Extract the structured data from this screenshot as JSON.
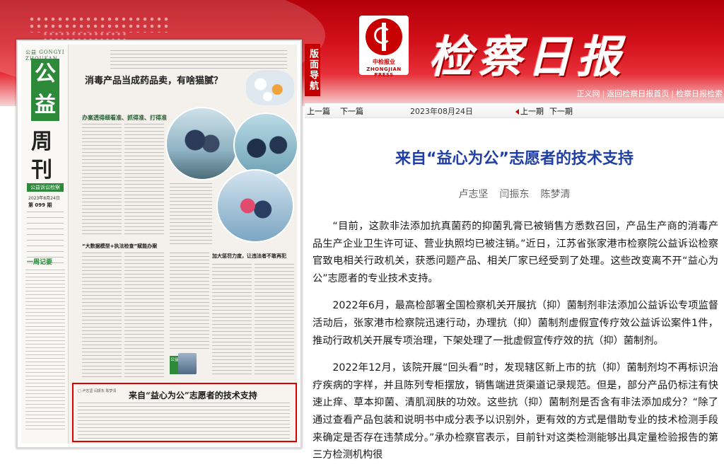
{
  "header": {
    "brand_title": "检察日报",
    "logo_cn": "中检报业",
    "logo_en": "ZHONGJIAN PRESS",
    "nav_tag": "版面导航",
    "links": [
      "正义网",
      "返回检察日报首页",
      "检察日报检索"
    ],
    "link_separator": "|"
  },
  "navbar": {
    "prev_article": "上一篇",
    "next_article": "下一篇",
    "date": "2023年08月24日",
    "prev_issue": "上一期",
    "next_issue": "下一期"
  },
  "newspaper": {
    "masthead_small": "公益 GONGYI ZHOUKAN",
    "masthead_gong": "公",
    "masthead_yi": "益",
    "masthead_zhou": "周",
    "masthead_kan": "刊",
    "section_bar": "公益诉讼检察",
    "date_line": "2023年8月24日",
    "issue": "第 099 期",
    "week_title": "一周记要",
    "main_headline": "消毒产品当成药品卖，有啥猫腻？",
    "sub_green": "办案透得细看准、抓得准、打得准",
    "sub_left": "“大数据模型+执法检查”赋能办案",
    "sub_right": "加大惩罚力度，让违法者不敢再犯",
    "highlight_title": "来自“益心为公”志愿者的技术支持",
    "highlight_authors": "□ 卢志坚 闫振东 陈梦清",
    "badge": "公益"
  },
  "article": {
    "title": "来自“益心为公”志愿者的技术支持",
    "authors": [
      "卢志坚",
      "闫振东",
      "陈梦清"
    ],
    "paragraphs": [
      "“目前，这款非法添加抗真菌药的抑菌乳膏已被销售方悉数召回，产品生产商的消毒产品生产企业卫生许可证、营业执照均已被注销。”近日，江苏省张家港市检察院公益诉讼检察官致电相关行政机关，获悉问题产品、相关厂家已经受到了处理。这些改变离不开“益心为公”志愿者的专业技术支持。",
      "2022年6月，最高检部署全国检察机关开展抗（抑）菌制剂非法添加公益诉讼专项监督活动后，张家港市检察院迅速行动，办理抗（抑）菌制剂虚假宣传疗效公益诉讼案件1件，推动行政机关开展专项治理，下架处理了一批虚假宣传疗效的抗（抑）菌制剂。",
      "2022年12月，该院开展“回头看”时，发现辖区新上市的抗（抑）菌制剂均不再标识治疗疾病的字样，并且陈列专柜摆放，销售端进货渠道记录规范。但是，部分产品仍标注有快速止痒、草本抑菌、清肌润肤的功效。这些抗（抑）菌制剂是否含有非法添加成分？“除了通过查看产品包装和说明书中成分表予以识别外，更有效的方式是借助专业的技术检测手段来确定是否存在违禁成分。”承办检察官表示，目前针对这类检测能够出具定量检验报告的第三方检测机构很"
    ]
  },
  "colors": {
    "banner_red": "#c40000",
    "title_blue": "#1e3fa6",
    "highlight_red": "#e00000",
    "green": "#2d8a3a"
  }
}
